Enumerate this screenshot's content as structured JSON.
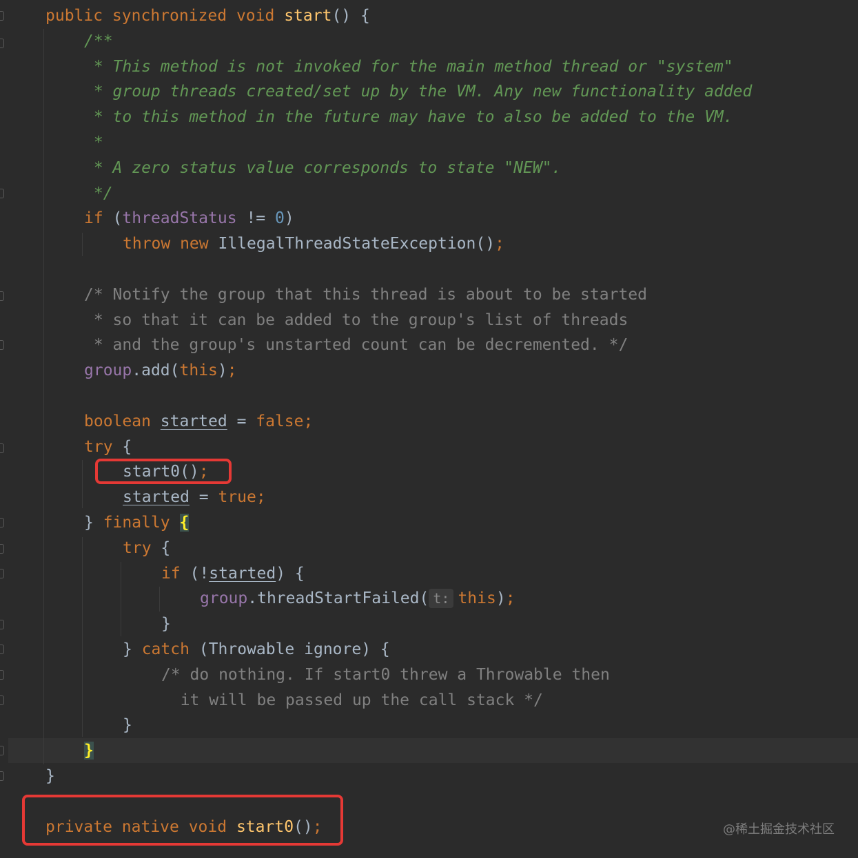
{
  "editor": {
    "lines": [
      {
        "indent": 1,
        "tokens": [
          {
            "t": "public synchronized void ",
            "c": "kw"
          },
          {
            "t": "start",
            "c": "fn"
          },
          {
            "t": "() {",
            "c": "plain"
          }
        ]
      },
      {
        "indent": 2,
        "tokens": [
          {
            "t": "/**",
            "c": "doc"
          }
        ]
      },
      {
        "indent": 2,
        "tokens": [
          {
            "t": " * This method is not invoked for the main method thread or \"system\"",
            "c": "doc"
          }
        ]
      },
      {
        "indent": 2,
        "tokens": [
          {
            "t": " * group threads created/set up by the VM. Any new functionality added",
            "c": "doc"
          }
        ]
      },
      {
        "indent": 2,
        "tokens": [
          {
            "t": " * to this method in the future may have to also be added to the VM.",
            "c": "doc"
          }
        ]
      },
      {
        "indent": 2,
        "tokens": [
          {
            "t": " *",
            "c": "doc"
          }
        ]
      },
      {
        "indent": 2,
        "tokens": [
          {
            "t": " * A zero status value corresponds to state \"NEW\".",
            "c": "doc"
          }
        ]
      },
      {
        "indent": 2,
        "tokens": [
          {
            "t": " */",
            "c": "doc"
          }
        ]
      },
      {
        "indent": 2,
        "tokens": [
          {
            "t": "if",
            "c": "kw"
          },
          {
            "t": " (",
            "c": "plain"
          },
          {
            "t": "threadStatus",
            "c": "field"
          },
          {
            "t": " != ",
            "c": "plain"
          },
          {
            "t": "0",
            "c": "num"
          },
          {
            "t": ")",
            "c": "plain"
          }
        ]
      },
      {
        "indent": 3,
        "tokens": [
          {
            "t": "throw new ",
            "c": "kw"
          },
          {
            "t": "IllegalThreadStateException()",
            "c": "plain"
          },
          {
            "t": ";",
            "c": "kw"
          }
        ]
      },
      {
        "indent": 0,
        "tokens": []
      },
      {
        "indent": 2,
        "tokens": [
          {
            "t": "/* Notify the group that this thread is about to be started",
            "c": "comment"
          }
        ]
      },
      {
        "indent": 2,
        "tokens": [
          {
            "t": " * so that it can be added to the group's list of threads",
            "c": "comment"
          }
        ]
      },
      {
        "indent": 2,
        "tokens": [
          {
            "t": " * and the group's unstarted count can be decremented. */",
            "c": "comment"
          }
        ]
      },
      {
        "indent": 2,
        "tokens": [
          {
            "t": "group",
            "c": "field"
          },
          {
            "t": ".add(",
            "c": "plain"
          },
          {
            "t": "this",
            "c": "kw"
          },
          {
            "t": ")",
            "c": "plain"
          },
          {
            "t": ";",
            "c": "kw"
          }
        ]
      },
      {
        "indent": 0,
        "tokens": []
      },
      {
        "indent": 2,
        "tokens": [
          {
            "t": "boolean ",
            "c": "kw"
          },
          {
            "t": "started",
            "c": "plain under"
          },
          {
            "t": " = ",
            "c": "plain"
          },
          {
            "t": "false",
            "c": "kw"
          },
          {
            "t": ";",
            "c": "kw"
          }
        ]
      },
      {
        "indent": 2,
        "tokens": [
          {
            "t": "try",
            "c": "kw"
          },
          {
            "t": " {",
            "c": "plain"
          }
        ]
      },
      {
        "indent": 3,
        "tokens": [
          {
            "t": "start0()",
            "c": "plain"
          },
          {
            "t": ";",
            "c": "kw"
          }
        ]
      },
      {
        "indent": 3,
        "tokens": [
          {
            "t": "started",
            "c": "plain under"
          },
          {
            "t": " = ",
            "c": "plain"
          },
          {
            "t": "true",
            "c": "kw"
          },
          {
            "t": ";",
            "c": "kw"
          }
        ]
      },
      {
        "indent": 2,
        "tokens": [
          {
            "t": "} ",
            "c": "plain"
          },
          {
            "t": "finally",
            "c": "kw"
          },
          {
            "t": " ",
            "c": "plain"
          },
          {
            "t": "{",
            "c": "brace-match"
          }
        ]
      },
      {
        "indent": 3,
        "tokens": [
          {
            "t": "try",
            "c": "kw"
          },
          {
            "t": " {",
            "c": "plain"
          }
        ]
      },
      {
        "indent": 4,
        "tokens": [
          {
            "t": "if",
            "c": "kw"
          },
          {
            "t": " (!",
            "c": "plain"
          },
          {
            "t": "started",
            "c": "plain under"
          },
          {
            "t": ") {",
            "c": "plain"
          }
        ]
      },
      {
        "indent": 5,
        "tokens": [
          {
            "t": "group",
            "c": "field"
          },
          {
            "t": ".threadStartFailed(",
            "c": "plain"
          },
          {
            "t": "t:",
            "c": "hint"
          },
          {
            "t": "this",
            "c": "kw"
          },
          {
            "t": ")",
            "c": "plain"
          },
          {
            "t": ";",
            "c": "kw"
          }
        ]
      },
      {
        "indent": 4,
        "tokens": [
          {
            "t": "}",
            "c": "plain"
          }
        ]
      },
      {
        "indent": 3,
        "tokens": [
          {
            "t": "} ",
            "c": "plain"
          },
          {
            "t": "catch",
            "c": "kw"
          },
          {
            "t": " (Throwable ignore) {",
            "c": "plain"
          }
        ]
      },
      {
        "indent": 4,
        "tokens": [
          {
            "t": "/* do nothing. If start0 threw a Throwable then",
            "c": "comment"
          }
        ]
      },
      {
        "indent": 4,
        "tokens": [
          {
            "t": "  it will be passed up the call stack */",
            "c": "comment"
          }
        ]
      },
      {
        "indent": 3,
        "tokens": [
          {
            "t": "}",
            "c": "plain"
          }
        ]
      },
      {
        "indent": 2,
        "tokens": [
          {
            "t": "}",
            "c": "brace-match"
          }
        ]
      },
      {
        "indent": 1,
        "tokens": [
          {
            "t": "}",
            "c": "plain"
          }
        ]
      },
      {
        "indent": 0,
        "tokens": []
      },
      {
        "indent": 1,
        "tokens": [
          {
            "t": "private native void ",
            "c": "kw"
          },
          {
            "t": "start0",
            "c": "fn"
          },
          {
            "t": "()",
            "c": "plain"
          },
          {
            "t": ";",
            "c": "kw"
          }
        ]
      }
    ]
  },
  "watermark": "@稀土掘金技术社区",
  "colors": {
    "background": "#2b2b2b",
    "keyword": "#cc7832",
    "method": "#ffc66d",
    "field": "#9876aa",
    "number": "#6897bb",
    "doc_comment": "#629755",
    "comment": "#808080",
    "plain": "#a9b7c6",
    "highlight_box": "#e53935"
  }
}
